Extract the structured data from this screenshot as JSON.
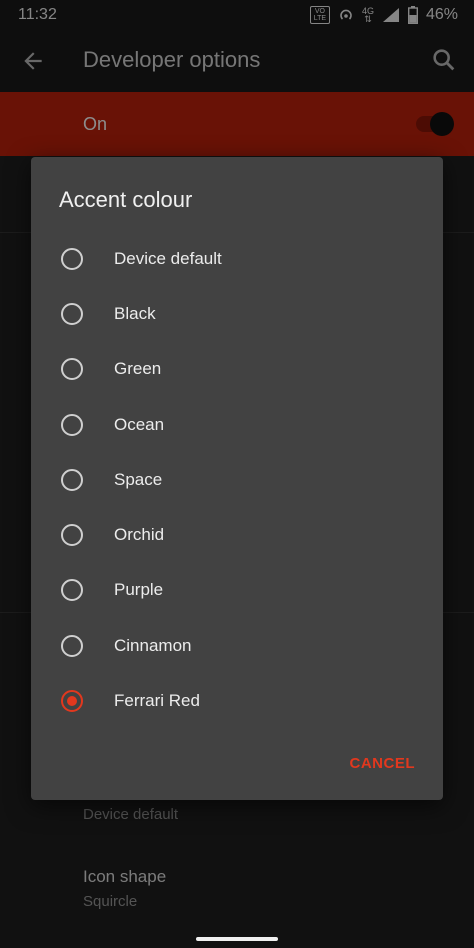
{
  "status_bar": {
    "time": "11:32",
    "volte": "VO LTE",
    "network": "4G",
    "battery": "46%"
  },
  "app_bar": {
    "title": "Developer options",
    "back_icon": "back-arrow-icon",
    "search_icon": "search-icon"
  },
  "master_switch": {
    "label": "On",
    "checked": true
  },
  "background_items": [
    {
      "title": "",
      "summary": "Device default"
    },
    {
      "title": "Icon shape",
      "summary": "Squircle"
    }
  ],
  "dialog": {
    "title": "Accent colour",
    "options": [
      {
        "label": "Device default",
        "selected": false
      },
      {
        "label": "Black",
        "selected": false
      },
      {
        "label": "Green",
        "selected": false
      },
      {
        "label": "Ocean",
        "selected": false
      },
      {
        "label": "Space",
        "selected": false
      },
      {
        "label": "Orchid",
        "selected": false
      },
      {
        "label": "Purple",
        "selected": false
      },
      {
        "label": "Cinnamon",
        "selected": false
      },
      {
        "label": "Ferrari Red",
        "selected": true
      }
    ],
    "cancel_label": "CANCEL"
  },
  "colors": {
    "accent": "#e2381e",
    "dialog_bg": "#424242",
    "bar_red": "#c0210c"
  }
}
